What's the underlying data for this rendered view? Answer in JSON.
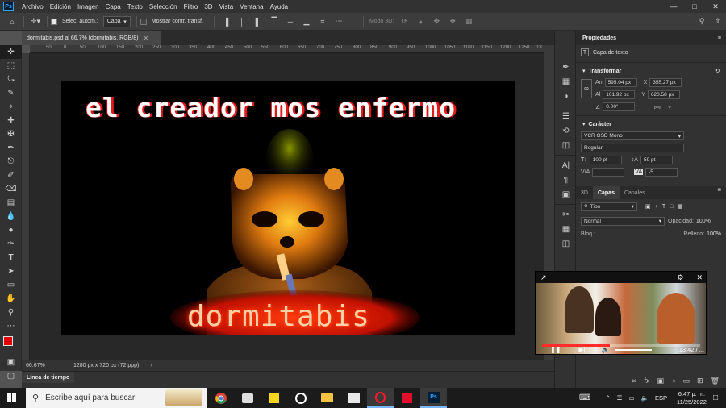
{
  "menubar": {
    "logo": "Ps",
    "items": [
      "Archivo",
      "Edición",
      "Imagen",
      "Capa",
      "Texto",
      "Selección",
      "Filtro",
      "3D",
      "Vista",
      "Ventana",
      "Ayuda"
    ]
  },
  "options_bar": {
    "auto_select_label": "Selec. autom.:",
    "auto_select_value": "Capa",
    "show_transform_label": "Mostrar contr. transf.",
    "mode3d_label": "Modo 3D:"
  },
  "document": {
    "tab_title": "dormitabis.psd al 66.7% (dormitabis, RGB/8)",
    "zoom": "66.67%",
    "size_info": "1280 px x 720 px (72 ppp)",
    "title_text": "el creador mos enfermo",
    "subtitle_text": "dormitabis"
  },
  "rulers": {
    "h_ticks": [
      "50",
      "0",
      "50",
      "100",
      "150",
      "200",
      "250",
      "300",
      "350",
      "400",
      "450",
      "500",
      "550",
      "600",
      "650",
      "700",
      "750",
      "800",
      "850",
      "900",
      "950",
      "1000",
      "1050",
      "1100",
      "1150",
      "1200",
      "1250",
      "13"
    ]
  },
  "timeline": {
    "label": "Línea de tiempo"
  },
  "properties": {
    "header": "Propiedades",
    "layer_type": "Capa de texto",
    "transform_title": "Transformar",
    "w_label": "An",
    "w_value": "595.04 px",
    "x_label": "X",
    "x_value": "355.27 px",
    "h_label": "Al",
    "h_value": "101.92 px",
    "y_label": "Y",
    "y_value": "620.58 px",
    "angle_value": "0.00°",
    "character_title": "Carácter",
    "font_name": "VCR OSD Mono",
    "font_style": "Regular",
    "font_size": "100 pt",
    "leading": "59 pt",
    "kerning_label": "V/A",
    "tracking_value": "-5"
  },
  "layers": {
    "tabs": [
      "3D",
      "Capas",
      "Canales"
    ],
    "filter_value": "Tipo",
    "blend_mode": "Normal",
    "opacity_label": "Opacidad:",
    "opacity_value": "100%",
    "lock_label": "Bloq.:",
    "fill_label": "Relleno:",
    "fill_value": "100%"
  },
  "mini_player": {
    "time": "13:42 / ...",
    "progress": 0.43
  },
  "taskbar": {
    "search_placeholder": "Escribe aquí para buscar",
    "language": "ESP",
    "time": "6:47 p. m.",
    "date": "11/25/2022"
  },
  "colors": {
    "foreground": "#e00000",
    "background": "#000000",
    "accent_red": "#e31b1b"
  }
}
